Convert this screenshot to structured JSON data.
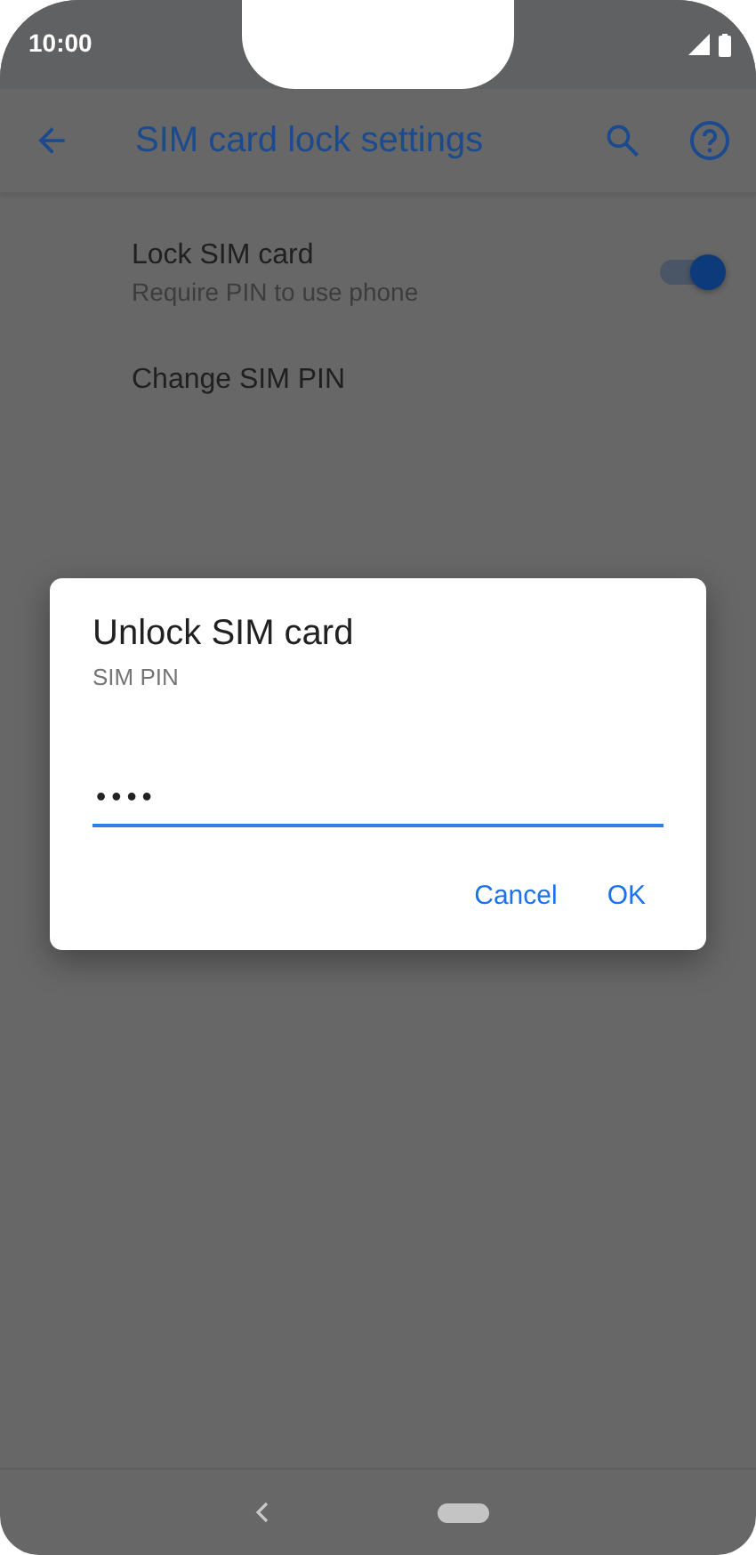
{
  "status_bar": {
    "time": "10:00"
  },
  "app_bar": {
    "title": "SIM card lock settings"
  },
  "settings": [
    {
      "kind": "toggle",
      "title": "Lock SIM card",
      "subtitle": "Require PIN to use phone",
      "on": true
    },
    {
      "kind": "plain",
      "title": "Change SIM PIN"
    }
  ],
  "dialog": {
    "title": "Unlock SIM card",
    "label": "SIM PIN",
    "value": "••••",
    "buttons": [
      "Cancel",
      "OK"
    ]
  }
}
